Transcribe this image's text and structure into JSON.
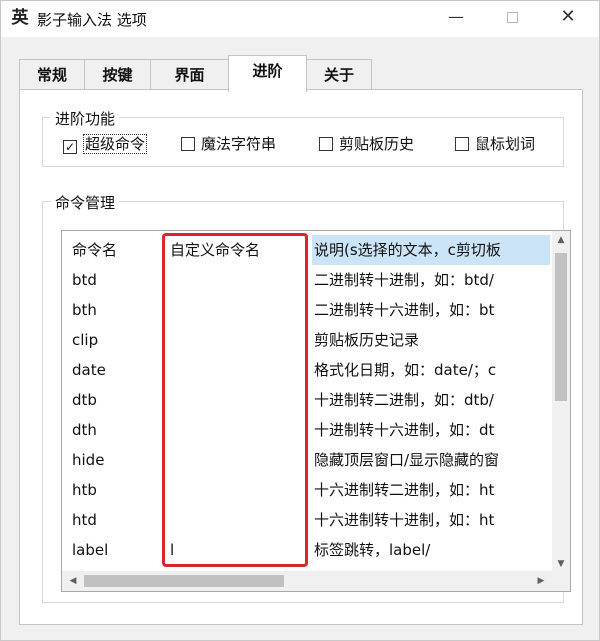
{
  "window": {
    "title": "影子输入法 选项",
    "icon_glyph": "英",
    "icon_name": "app-icon"
  },
  "titlebar": {
    "minimize_glyph": "—",
    "close_glyph": "✕"
  },
  "tabs": [
    {
      "label": "常规",
      "active": false
    },
    {
      "label": "按键",
      "active": false
    },
    {
      "label": "界面",
      "active": false
    },
    {
      "label": "进阶",
      "active": true
    },
    {
      "label": "关于",
      "active": false
    }
  ],
  "advanced": {
    "legend": "进阶功能",
    "options": [
      {
        "label": "超级命令",
        "checked": true
      },
      {
        "label": "魔法字符串",
        "checked": false
      },
      {
        "label": "剪贴板历史",
        "checked": false
      },
      {
        "label": "鼠标划词",
        "checked": false
      }
    ]
  },
  "commands": {
    "legend": "命令管理",
    "columns": [
      "命令名",
      "自定义命令名",
      "说明(s选择的文本，c剪切板"
    ],
    "rows": [
      {
        "name": "btd",
        "custom": "",
        "desc": "二进制转十进制，如：btd/"
      },
      {
        "name": "bth",
        "custom": "",
        "desc": "二进制转十六进制，如：bt"
      },
      {
        "name": "clip",
        "custom": "",
        "desc": "剪贴板历史记录"
      },
      {
        "name": "date",
        "custom": "",
        "desc": "格式化日期，如：date/；c"
      },
      {
        "name": "dtb",
        "custom": "",
        "desc": "十进制转二进制，如：dtb/"
      },
      {
        "name": "dth",
        "custom": "",
        "desc": "十进制转十六进制，如：dt"
      },
      {
        "name": "hide",
        "custom": "",
        "desc": "隐藏顶层窗口/显示隐藏的窗"
      },
      {
        "name": "htb",
        "custom": "",
        "desc": "十六进制转二进制，如：ht"
      },
      {
        "name": "htd",
        "custom": "",
        "desc": "十六进制转十进制，如：ht"
      },
      {
        "name": "label",
        "custom": "l",
        "desc": "标签跳转，label/"
      }
    ],
    "highlight_color": "#d9262c",
    "header_highlight_color": "#cce4f7"
  },
  "scrollbar_arrows": {
    "up": "▲",
    "down": "▼",
    "left": "◀",
    "right": "▶"
  }
}
